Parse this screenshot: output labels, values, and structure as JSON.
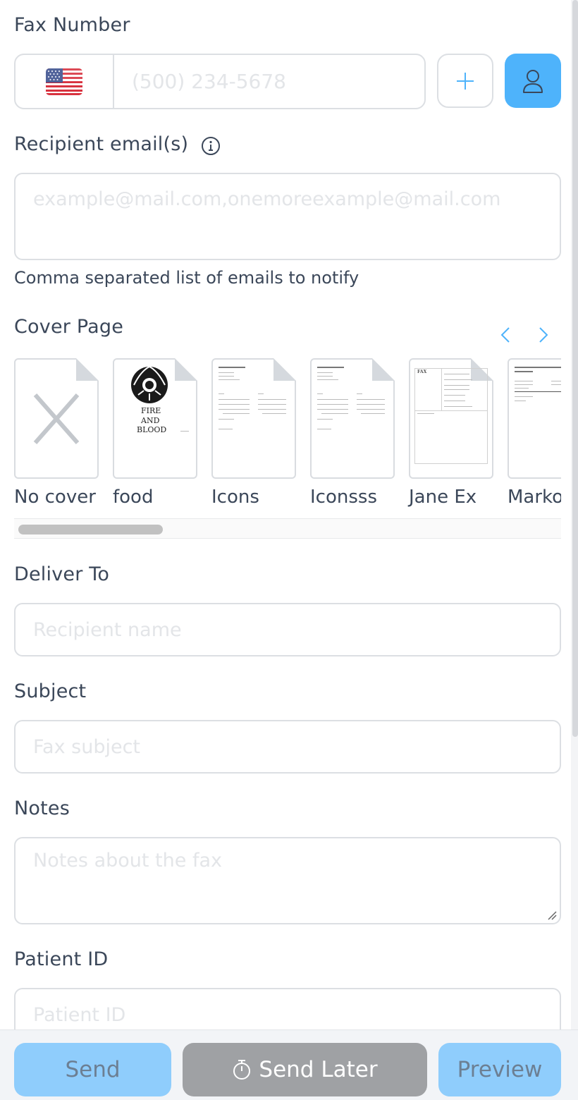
{
  "fax_number": {
    "label": "Fax Number",
    "country_flag": "us-flag",
    "placeholder": "(500) 234-5678",
    "add_button_icon": "plus-icon",
    "contacts_button_icon": "user-icon"
  },
  "recipient_emails": {
    "label": "Recipient email(s)",
    "info_icon": "info-icon",
    "placeholder": "example@mail.com,onemoreexample@mail.com",
    "helper": "Comma separated list of emails to notify"
  },
  "cover_page": {
    "label": "Cover Page",
    "prev_icon": "chevron-left-icon",
    "next_icon": "chevron-right-icon",
    "covers": [
      {
        "name": "No cover"
      },
      {
        "name": "food",
        "logo_text": [
          "FIRE",
          "AND",
          "BLOOD"
        ]
      },
      {
        "name": "Icons"
      },
      {
        "name": "Iconsss"
      },
      {
        "name": "Jane Ex",
        "thumb_heading": "FAX"
      },
      {
        "name": "Marko"
      }
    ]
  },
  "deliver_to": {
    "label": "Deliver To",
    "placeholder": "Recipient name"
  },
  "subject": {
    "label": "Subject",
    "placeholder": "Fax subject"
  },
  "notes": {
    "label": "Notes",
    "placeholder": "Notes about the fax"
  },
  "patient_id": {
    "label": "Patient ID",
    "placeholder": "Patient ID"
  },
  "footer": {
    "send": "Send",
    "send_later": "Send Later",
    "send_later_icon": "stopwatch-icon",
    "preview": "Preview"
  },
  "colors": {
    "accent": "#4eb3fb",
    "accent_disabled": "#8fcdfc",
    "send_later_bg": "#9fa1a4",
    "border": "#dcdfe3",
    "label_text": "#3b4759"
  }
}
